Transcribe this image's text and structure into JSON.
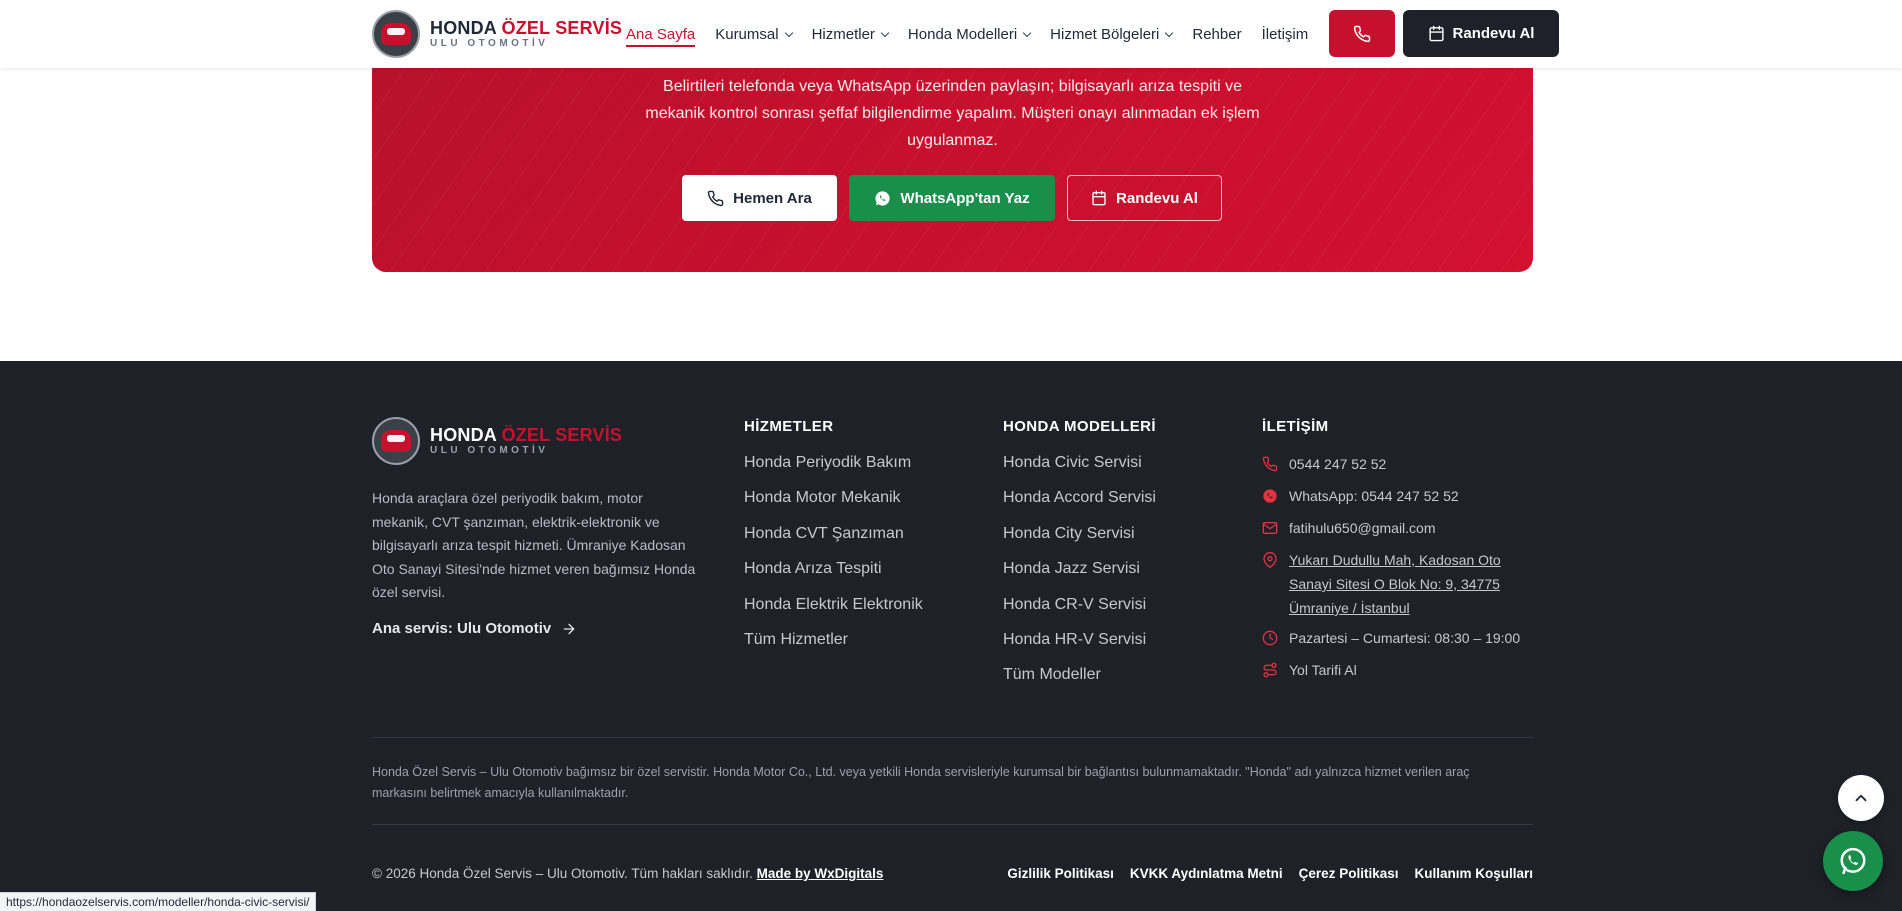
{
  "brand": {
    "title_white": "HONDA ",
    "title_red": "ÖZEL SERVİS",
    "subtitle": "ULU OTOMOTİV"
  },
  "nav": {
    "items": [
      {
        "label": "Ana Sayfa"
      },
      {
        "label": "Kurumsal"
      },
      {
        "label": "Hizmetler"
      },
      {
        "label": "Honda Modelleri"
      },
      {
        "label": "Hizmet Bölgeleri"
      },
      {
        "label": "Rehber"
      },
      {
        "label": "İletişim"
      }
    ],
    "appointment_label": "Randevu Al"
  },
  "cta": {
    "line1": "Belirtileri telefonda veya WhatsApp üzerinden paylaşın; bilgisayarlı arıza tespiti ve",
    "line2": "mekanik kontrol sonrası şeffaf bilgilendirme yapalım. Müşteri onayı alınmadan ek işlem",
    "line3": "uygulanmaz.",
    "call_label": "Hemen Ara",
    "whatsapp_label": "WhatsApp'tan Yaz",
    "appointment_label": "Randevu Al"
  },
  "footer": {
    "about": "Honda araçlara özel periyodik bakım, motor mekanik, CVT şanzıman, elektrik-elektronik ve bilgisayarlı arıza tespit hizmeti. Ümraniye Kadosan Oto Sanayi Sitesi'nde hizmet veren bağımsız Honda özel servisi.",
    "main_service": "Ana servis: Ulu Otomotiv",
    "services": {
      "heading": "HİZMETLER",
      "items": [
        "Honda Periyodik Bakım",
        "Honda Motor Mekanik",
        "Honda CVT Şanzıman",
        "Honda Arıza Tespiti",
        "Honda Elektrik Elektronik",
        "Tüm Hizmetler"
      ]
    },
    "models": {
      "heading": "HONDA MODELLERİ",
      "items": [
        "Honda Civic Servisi",
        "Honda Accord Servisi",
        "Honda City Servisi",
        "Honda Jazz Servisi",
        "Honda CR-V Servisi",
        "Honda HR-V Servisi",
        "Tüm Modeller"
      ]
    },
    "contact": {
      "heading": "İLETİŞİM",
      "phone": "0544 247 52 52",
      "whatsapp": "WhatsApp: 0544 247 52 52",
      "email": "fatihulu650@gmail.com",
      "address_1": "Yukarı Dudullu Mah, Kadosan Oto",
      "address_2": "Sanayi Sitesi O Blok No: 9, 34775",
      "address_3": "Ümraniye / İstanbul",
      "hours": "Pazartesi – Cumartesi: 08:30 – 19:00",
      "directions": "Yol Tarifi Al"
    },
    "disclaimer_1": "Honda Özel Servis – Ulu Otomotiv bağımsız bir özel servistir. Honda Motor Co., Ltd. veya yetkili Honda servisleriyle kurumsal bir bağlantısı bulunmamaktadır. \"Honda\" adı yalnızca hizmet verilen araç",
    "disclaimer_2": "markasını belirtmek amacıyla kullanılmaktadır.",
    "copyright": "© 2026 Honda Özel Servis – Ulu Otomotiv. Tüm hakları saklıdır.",
    "made_by": "Made by WxDigitals",
    "legal": [
      "Gizlilik Politikası",
      "KVKK Aydınlatma Metni",
      "Çerez Politikası",
      "Kullanım Koşulları"
    ]
  },
  "status_url": "https://hondaozelservis.com/modeller/honda-civic-servisi/",
  "colors": {
    "primary_red": "#c8102e",
    "dark": "#1e2129",
    "whatsapp_green": "#1a8e4b",
    "footer_bg": "#1f2129"
  }
}
